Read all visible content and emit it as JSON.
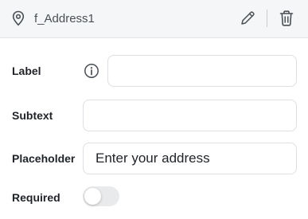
{
  "header": {
    "field_name": "f_Address1",
    "icons": {
      "field_type": "location-pin-icon",
      "edit": "pencil-icon",
      "delete": "trash-icon"
    }
  },
  "form": {
    "label": {
      "label": "Label",
      "value": "",
      "info_icon": "info-icon"
    },
    "subtext": {
      "label": "Subtext",
      "value": ""
    },
    "placeholder": {
      "label": "Placeholder",
      "value": "Enter your address"
    },
    "required": {
      "label": "Required",
      "checked": false
    }
  },
  "colors": {
    "header_bg": "#f5f6f7",
    "toggle_off": "#e9eaec",
    "border": "#dcdfe3"
  }
}
